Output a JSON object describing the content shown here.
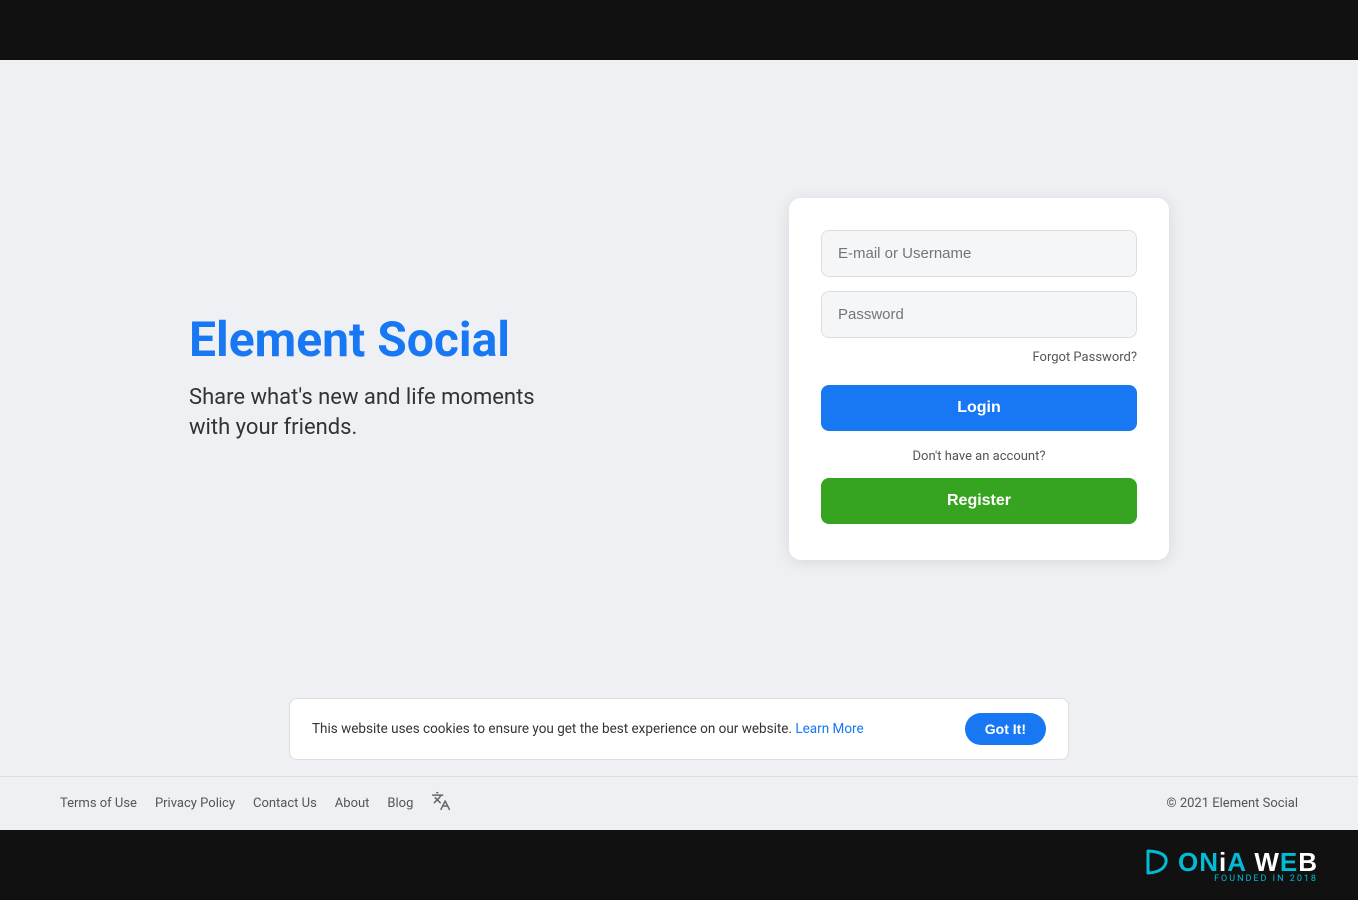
{
  "topBar": {},
  "branding": {
    "title": "Element Social",
    "subtitle_line1": "Share what's new and life moments",
    "subtitle_line2": "with your friends."
  },
  "loginCard": {
    "email_placeholder": "E-mail or Username",
    "password_placeholder": "Password",
    "forgot_password_label": "Forgot Password?",
    "login_button_label": "Login",
    "no_account_text": "Don't have an account?",
    "register_button_label": "Register"
  },
  "cookieBar": {
    "message": "This website uses cookies to ensure you get the best experience on our website.",
    "learn_more_label": "Learn More",
    "got_it_label": "Got It!"
  },
  "footer": {
    "links": [
      {
        "label": "Terms of Use"
      },
      {
        "label": "Privacy Policy"
      },
      {
        "label": "Contact Us"
      },
      {
        "label": "About"
      },
      {
        "label": "Blog"
      }
    ],
    "translate_icon": "🌐",
    "copyright": "© 2021 Element Social"
  },
  "bottomBar": {
    "logo_text_cyan": "D",
    "logo_main": "ONiA",
    "logo_web": "WEB",
    "founded": "FOUNDED IN 2018"
  }
}
